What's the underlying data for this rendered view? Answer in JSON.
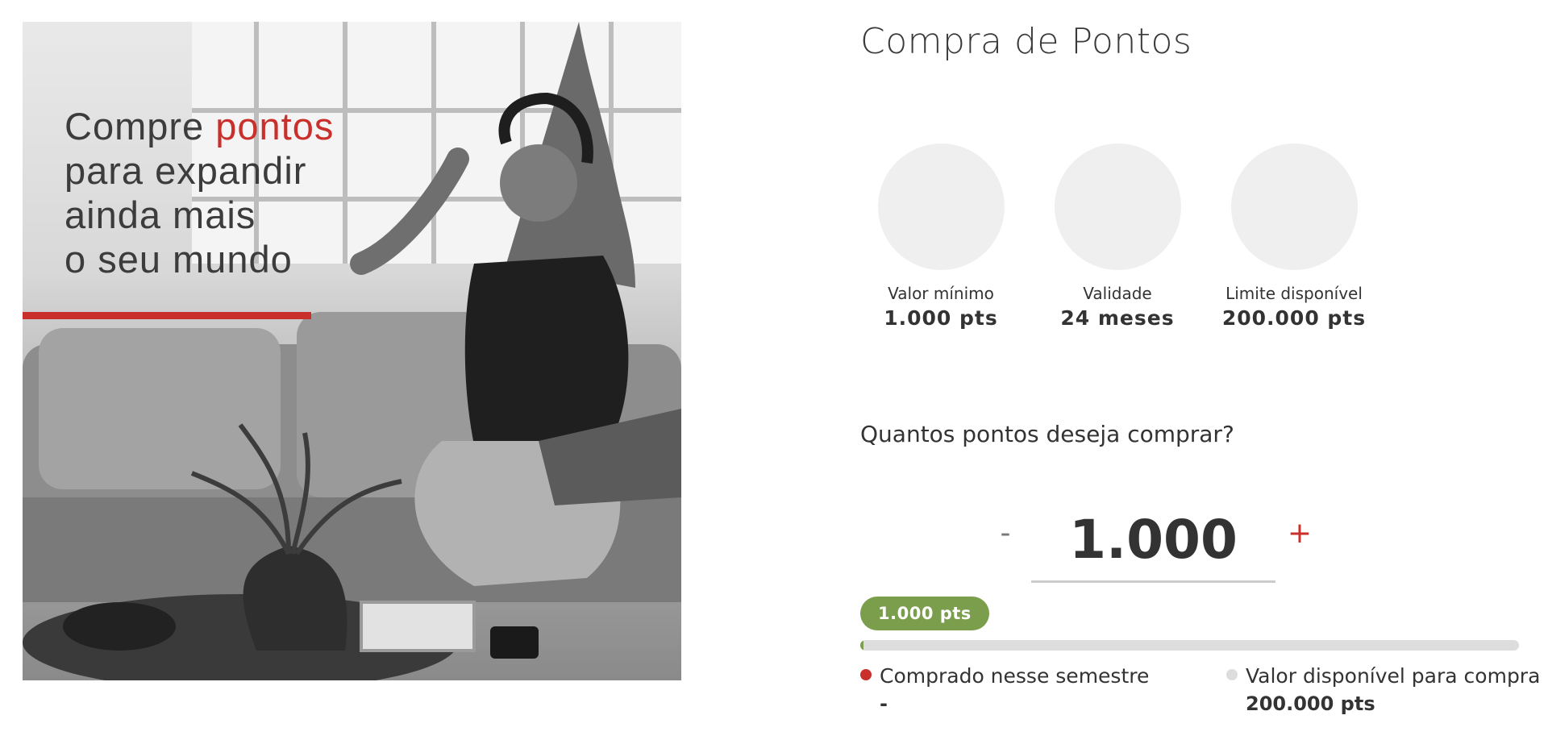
{
  "hero": {
    "line1_prefix": "Compre",
    "line1_accent": "pontos",
    "line2": "para expandir",
    "line3": "ainda mais",
    "line4": "o seu mundo",
    "accent_color": "#c9302c"
  },
  "page": {
    "title": "Compra de Pontos"
  },
  "info": [
    {
      "label": "Valor mínimo",
      "value": "1.000 pts"
    },
    {
      "label": "Validade",
      "value": "24 meses"
    },
    {
      "label": "Limite disponível",
      "value": "200.000 pts"
    }
  ],
  "purchase": {
    "question": "Quantos pontos deseja comprar?",
    "minus_label": "-",
    "plus_label": "+",
    "amount": "1.000",
    "badge": "1.000 pts",
    "progress_fraction": 0.005,
    "badge_color": "#7b9e4c"
  },
  "legend": {
    "purchased": {
      "label": "Comprado nesse semestre",
      "value": "-",
      "color": "#c9302c"
    },
    "available": {
      "label": "Valor disponível para compra",
      "value": "200.000 pts",
      "color": "#dddddd"
    }
  }
}
